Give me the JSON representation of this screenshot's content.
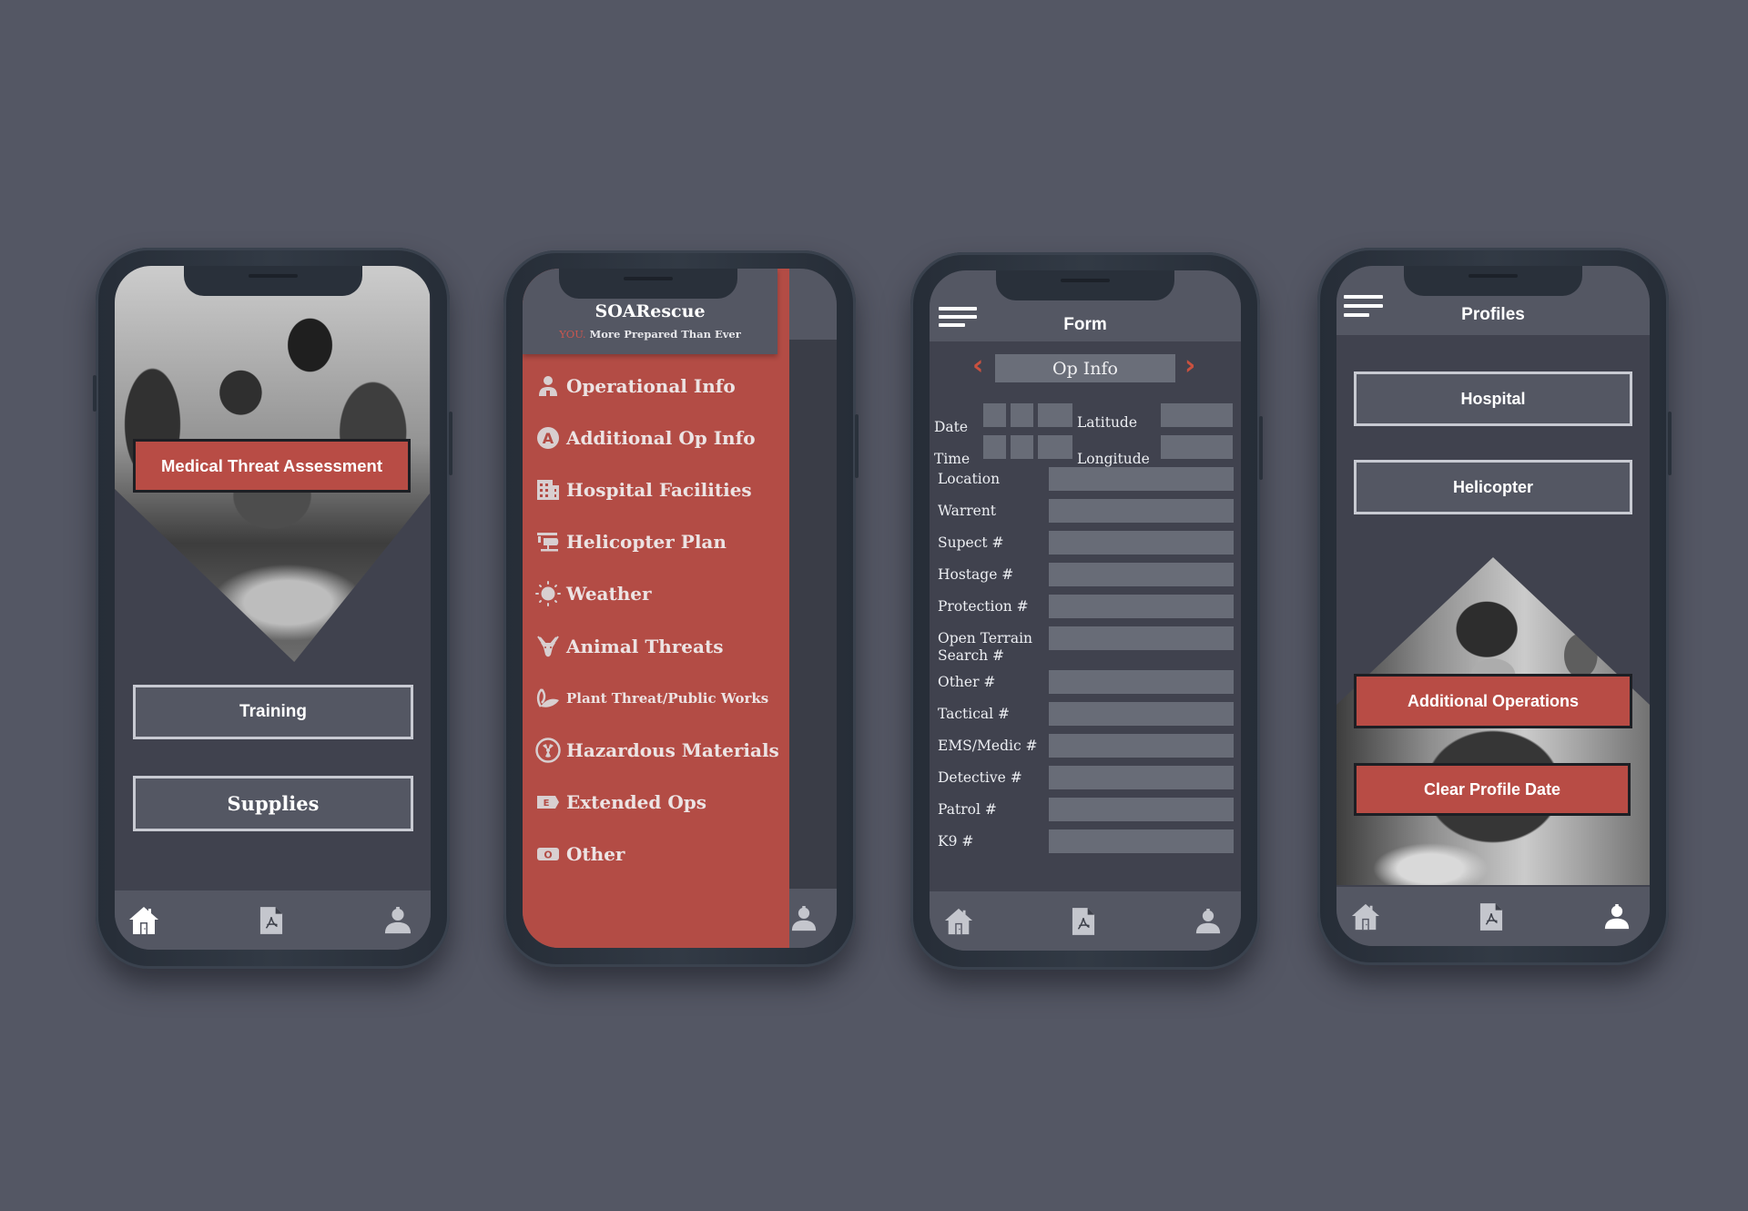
{
  "colors": {
    "background": "#545764",
    "accent_red": "#b84c45",
    "screen_dark": "#40424e",
    "bar_gray": "#545763",
    "input_gray": "#686c77",
    "outline": "#c8cad2"
  },
  "phone1": {
    "hero_image": "soldiers-medical-photo",
    "medical_threat_button": "Medical Threat Assessment",
    "training_button": "Training",
    "supplies_button": "Supplies",
    "bottom_nav": [
      {
        "icon": "home-icon",
        "active": true
      },
      {
        "icon": "pdf-document-icon",
        "active": false
      },
      {
        "icon": "user-profile-icon",
        "active": false
      }
    ]
  },
  "phone2": {
    "app_title": "SOARescue",
    "tagline_highlight": "YOU.",
    "tagline_rest": " More Prepared Than Ever",
    "menu": [
      {
        "icon": "operator-icon",
        "label": "Operational Info"
      },
      {
        "icon": "letter-a-circle-icon",
        "label": "Additional Op Info"
      },
      {
        "icon": "building-icon",
        "label": "Hospital Facilities"
      },
      {
        "icon": "helicopter-icon",
        "label": "Helicopter Plan"
      },
      {
        "icon": "sun-icon",
        "label": "Weather"
      },
      {
        "icon": "deer-icon",
        "label": "Animal Threats"
      },
      {
        "icon": "leaf-icon",
        "label": "Plant Threat/Public Works"
      },
      {
        "icon": "radiation-icon",
        "label": "Hazardous Materials"
      },
      {
        "icon": "letter-e-tag-icon",
        "label": "Extended Ops"
      },
      {
        "icon": "letter-o-tag-icon",
        "label": "Other"
      }
    ]
  },
  "phone3": {
    "title": "Form",
    "section": "Op Info",
    "date_label": "Date",
    "time_label": "Time",
    "latitude_label": "Latitude",
    "longitude_label": "Longitude",
    "fields": [
      {
        "label": "Location",
        "value": ""
      },
      {
        "label": "Warrent",
        "value": ""
      },
      {
        "label": "Supect #",
        "value": ""
      },
      {
        "label": "Hostage #",
        "value": ""
      },
      {
        "label": "Protection #",
        "value": ""
      },
      {
        "label": "Open Terrain Search #",
        "value": ""
      },
      {
        "label": "Other #",
        "value": ""
      },
      {
        "label": "Tactical #",
        "value": ""
      },
      {
        "label": "EMS/Medic #",
        "value": ""
      },
      {
        "label": "Detective #",
        "value": ""
      },
      {
        "label": "Patrol #",
        "value": ""
      },
      {
        "label": "K9 #",
        "value": ""
      }
    ]
  },
  "phone4": {
    "title": "Profiles",
    "hospital_button": "Hospital",
    "helicopter_button": "Helicopter",
    "additional_operations_button": "Additional Operations",
    "clear_profile_button": "Clear Profile Date",
    "hero_image": "soldier-helmet-photo"
  }
}
